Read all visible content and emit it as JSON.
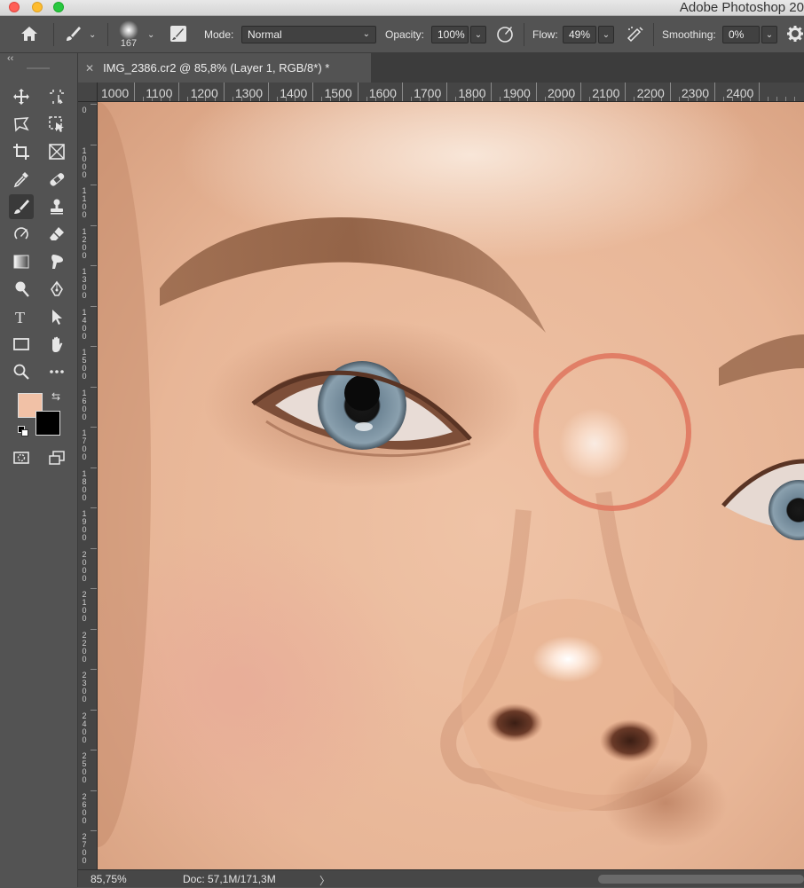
{
  "window": {
    "app_title": "Adobe Photoshop 20"
  },
  "options_bar": {
    "brush_size": "167",
    "mode_label": "Mode:",
    "mode_value": "Normal",
    "opacity_label": "Opacity:",
    "opacity_value": "100%",
    "flow_label": "Flow:",
    "flow_value": "49%",
    "smoothing_label": "Smoothing:",
    "smoothing_value": "0%"
  },
  "toolbox": {
    "collapse_glyph": "‹‹",
    "active_tool": "brush",
    "foreground_color": "#f1c1a6",
    "background_color": "#000000"
  },
  "document": {
    "tab_close": "✕",
    "tab_title": "IMG_2386.cr2 @ 85,8% (Layer 1, RGB/8*) *"
  },
  "ruler": {
    "h_labels": [
      "1000",
      "1100",
      "1200",
      "1300",
      "1400",
      "1500",
      "1600",
      "1700",
      "1800",
      "1900",
      "2000",
      "2100",
      "2200",
      "2300",
      "2400"
    ],
    "v_labels": [
      "0",
      "1000",
      "1100",
      "1200",
      "1300",
      "1400",
      "1500",
      "1600",
      "1700",
      "1800",
      "1900",
      "2000",
      "2100",
      "2200",
      "2300",
      "2400",
      "2500",
      "2600",
      "2700"
    ]
  },
  "status": {
    "zoom": "85,75%",
    "doc_info": "Doc: 57,1M/171,3M",
    "arrow": "〉"
  },
  "brush_cursor": {
    "color": "#e07860"
  }
}
